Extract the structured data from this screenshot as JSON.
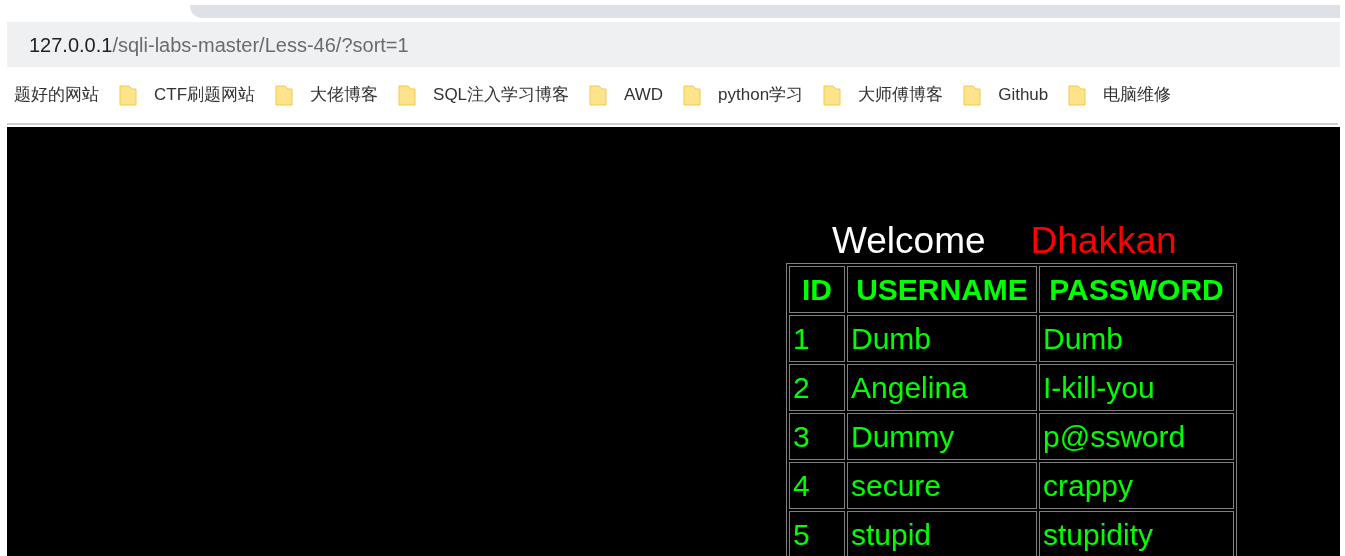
{
  "address_bar": {
    "host": "127.0.0.1",
    "path": "/sqli-labs-master/Less-46/?sort=1"
  },
  "bookmarks": [
    "题好的网站",
    "CTF刷题网站",
    "大佬博客",
    "SQL注入学习博客",
    "AWD",
    "python学习",
    "大师傅博客",
    "Github",
    "电脑维修"
  ],
  "page": {
    "greeting": "Welcome",
    "name": "Dhakkan",
    "table": {
      "columns": [
        "ID",
        "USERNAME",
        "PASSWORD"
      ],
      "rows": [
        [
          "1",
          "Dumb",
          "Dumb"
        ],
        [
          "2",
          "Angelina",
          "I-kill-you"
        ],
        [
          "3",
          "Dummy",
          "p@ssword"
        ],
        [
          "4",
          "secure",
          "crappy"
        ],
        [
          "5",
          "stupid",
          "stupidity"
        ]
      ]
    }
  }
}
